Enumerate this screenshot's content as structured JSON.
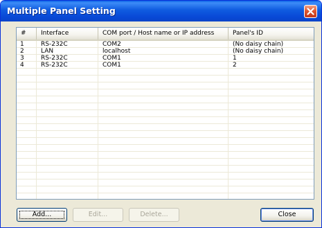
{
  "window": {
    "title": "Multiple Panel Setting"
  },
  "columns": [
    {
      "label": "#"
    },
    {
      "label": "Interface"
    },
    {
      "label": "COM port / Host name or IP address"
    },
    {
      "label": "Panel's ID"
    }
  ],
  "rows": [
    {
      "num": "1",
      "interface": "RS-232C",
      "address": "COM2",
      "panel_id": "(No daisy chain)"
    },
    {
      "num": "2",
      "interface": "LAN",
      "address": "localhost",
      "panel_id": "(No daisy chain)"
    },
    {
      "num": "3",
      "interface": "RS-232C",
      "address": "COM1",
      "panel_id": "1"
    },
    {
      "num": "4",
      "interface": "RS-232C",
      "address": "COM1",
      "panel_id": "2"
    }
  ],
  "buttons": {
    "add": "Add...",
    "edit": "Edit...",
    "delete": "Delete...",
    "close": "Close"
  },
  "colors": {
    "title_bar": "#0a4fd6",
    "close_button": "#e1572f",
    "dialog_background": "#ece9d8"
  }
}
